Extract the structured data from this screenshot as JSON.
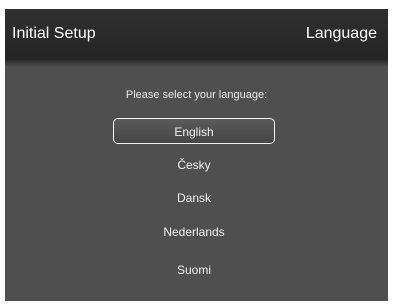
{
  "header": {
    "title": "Initial Setup",
    "section": "Language"
  },
  "prompt": "Please select your language:",
  "languages": [
    {
      "label": "English",
      "selected": true
    },
    {
      "label": "Česky",
      "selected": false
    },
    {
      "label": "Dansk",
      "selected": false
    },
    {
      "label": "Nederlands",
      "selected": false
    },
    {
      "label": "Suomi",
      "selected": false
    }
  ],
  "colors": {
    "header_bg": "#282828",
    "body_bg": "#4f4f4f",
    "text": "#ffffff",
    "selection_border": "#f4f4f4"
  }
}
